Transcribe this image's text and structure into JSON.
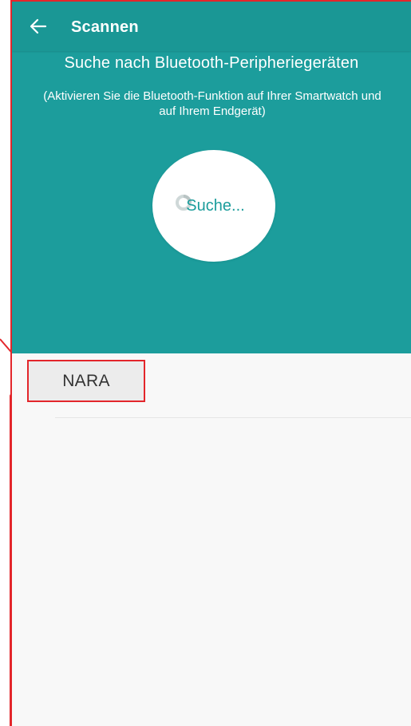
{
  "appbar": {
    "title": "Scannen",
    "back_icon": "arrow-left-icon"
  },
  "header": {
    "headline": "Suche nach Bluetooth-Peripheriegeräten",
    "subline": "(Aktivieren Sie die Bluetooth-Funktion auf Ihrer Smartwatch und auf Ihrem Endgerät)",
    "scan_label": "Suche...",
    "scan_icon": "spinner-icon"
  },
  "devices": [
    {
      "name": "NARA"
    }
  ],
  "colors": {
    "primary": "#1c9d9c",
    "appbar": "#1a9795",
    "highlight": "#e3262b",
    "list_background": "#f8f8f8"
  }
}
